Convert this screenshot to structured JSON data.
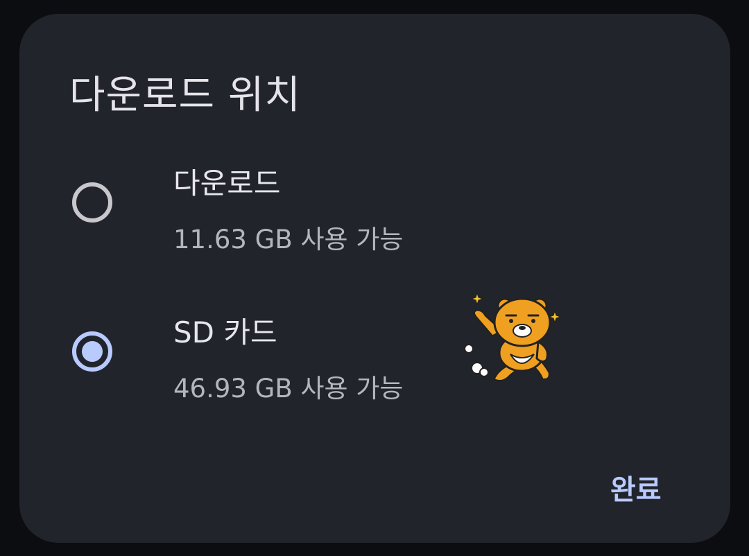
{
  "dialog": {
    "title": "다운로드 위치",
    "options": [
      {
        "name": "다운로드",
        "available": "11.63 GB 사용 가능",
        "selected": false
      },
      {
        "name": "SD 카드",
        "available": "46.93 GB 사용 가능",
        "selected": true
      }
    ],
    "done_label": "완료"
  },
  "sticker": {
    "icon": "bear-character-sticker-icon"
  },
  "colors": {
    "background": "#0c0d10",
    "surface": "#22242c",
    "accent": "#b9caff",
    "text_primary": "#e6e6ec",
    "text_secondary": "#b4b6be",
    "radio_unselected": "#c7c7cc",
    "sticker_body": "#f0a020"
  }
}
